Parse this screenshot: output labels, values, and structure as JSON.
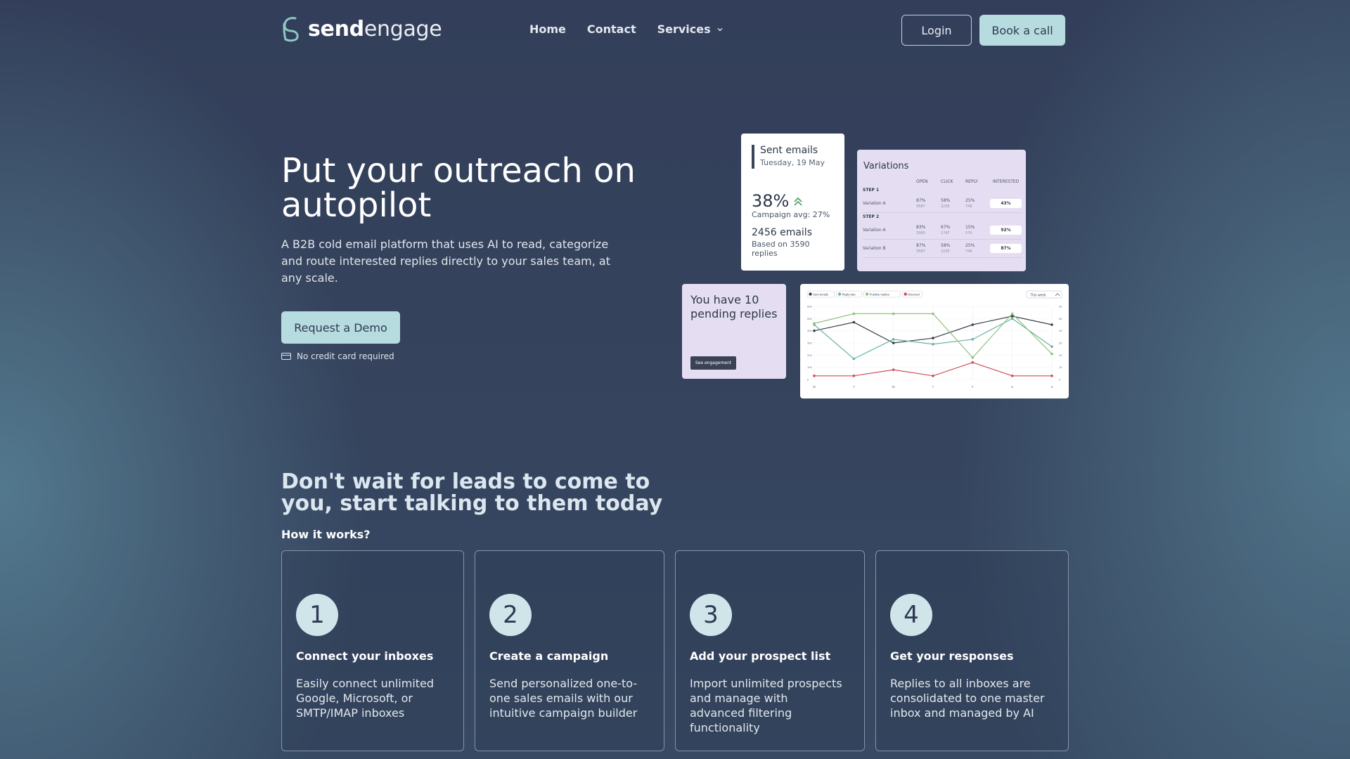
{
  "brand": {
    "name_bold": "send",
    "name_light": "engage"
  },
  "nav": {
    "links": [
      "Home",
      "Contact",
      "Services"
    ],
    "login": "Login",
    "book": "Book a call"
  },
  "hero": {
    "title": "Put your outreach on autopilot",
    "subtitle": "A B2B cold email platform that uses AI to read, categorize and route interested replies directly to your sales team, at any scale.",
    "cta": "Request a Demo",
    "note": "No credit card required"
  },
  "sent_card": {
    "title": "Sent emails",
    "date": "Tuesday, 19 May",
    "percent": "38%",
    "avg": "Campaign avg: 27%",
    "count": "2456 emails",
    "based": "Based on 3590 replies"
  },
  "variations_card": {
    "title": "Variations",
    "headers": [
      "OPEN",
      "CLICK",
      "REPLY",
      "INTERESTED"
    ],
    "steps": [
      {
        "label": "STEP 1",
        "rows": [
          {
            "name": "Variation A",
            "open": "87%",
            "open_n": "3587",
            "click": "58%",
            "click_n": "2235",
            "reply": "25%",
            "reply_n": "748",
            "interested": "43%"
          }
        ]
      },
      {
        "label": "STEP 2",
        "rows": [
          {
            "name": "Variation A",
            "open": "83%",
            "open_n": "3360",
            "click": "67%",
            "click_n": "1747",
            "reply": "15%",
            "reply_n": "570",
            "interested": "92%"
          },
          {
            "name": "Variation B",
            "open": "87%",
            "open_n": "3587",
            "click": "58%",
            "click_n": "2235",
            "reply": "25%",
            "reply_n": "748",
            "interested": "87%"
          }
        ]
      }
    ]
  },
  "pending_card": {
    "text": "You have 10 pending replies",
    "button": "See engagement"
  },
  "chart_card": {
    "range_select": "This week"
  },
  "chart_data": {
    "type": "line",
    "categories": [
      "M",
      "T",
      "W",
      "T",
      "F",
      "S",
      "S"
    ],
    "series": [
      {
        "name": "Sent emails",
        "color": "#3a3f4a",
        "values": [
          400,
          470,
          300,
          340,
          450,
          520,
          450
        ]
      },
      {
        "name": "Reply rate",
        "color": "#6ab3a8",
        "values": [
          450,
          170,
          330,
          290,
          330,
          500,
          270
        ]
      },
      {
        "name": "Positive replies",
        "color": "#8fc27e",
        "values": [
          460,
          540,
          540,
          540,
          180,
          540,
          210
        ]
      },
      {
        "name": "Bounced",
        "color": "#cf4a5a",
        "values": [
          30,
          30,
          80,
          30,
          140,
          30,
          30
        ]
      }
    ],
    "ylim": [
      0,
      600
    ],
    "left_ticks": [
      "0",
      "100",
      "200",
      "300",
      "400",
      "500",
      "600"
    ],
    "right_ticks": [
      "0",
      "10",
      "20",
      "30",
      "40",
      "50",
      "60"
    ],
    "grid": true,
    "legend": "top-left"
  },
  "section2": {
    "title": "Don't wait for leads to come to you, start talking to them today",
    "how": "How it works?",
    "steps": [
      {
        "num": "1",
        "title": "Connect your inboxes",
        "desc": "Easily connect unlimited Google, Microsoft, or SMTP/IMAP inboxes"
      },
      {
        "num": "2",
        "title": "Create a campaign",
        "desc": "Send personalized one-to-one sales emails with our intuitive campaign builder"
      },
      {
        "num": "3",
        "title": "Add your prospect list",
        "desc": "Import unlimited prospects and manage with advanced filtering functionality"
      },
      {
        "num": "4",
        "title": "Get your responses",
        "desc": "Replies to all inboxes are consolidated to one master inbox and managed by AI"
      }
    ]
  },
  "colors": {
    "background": "#343f59",
    "accent": "#b7dcdf",
    "card_lilac": "#e5def3"
  }
}
